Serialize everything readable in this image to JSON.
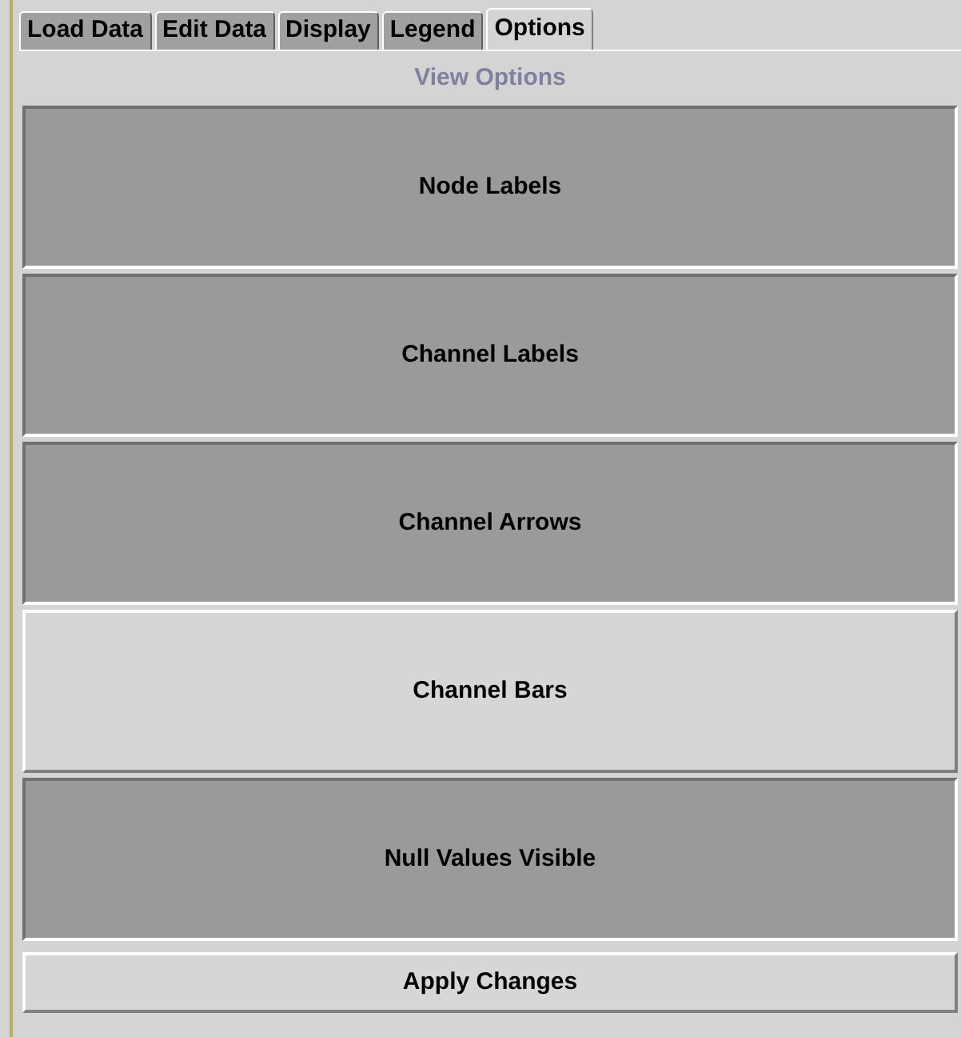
{
  "tabs": [
    {
      "label": "Load Data",
      "selected": false
    },
    {
      "label": "Edit Data",
      "selected": false
    },
    {
      "label": "Display",
      "selected": false
    },
    {
      "label": "Legend",
      "selected": false
    },
    {
      "label": "Options",
      "selected": true
    }
  ],
  "panel_title": "View Options",
  "toggles": [
    {
      "label": "Node Labels",
      "on": true
    },
    {
      "label": "Channel Labels",
      "on": true
    },
    {
      "label": "Channel Arrows",
      "on": true
    },
    {
      "label": "Channel Bars",
      "on": false
    },
    {
      "label": "Null Values Visible",
      "on": true
    }
  ],
  "apply_button": "Apply Changes"
}
